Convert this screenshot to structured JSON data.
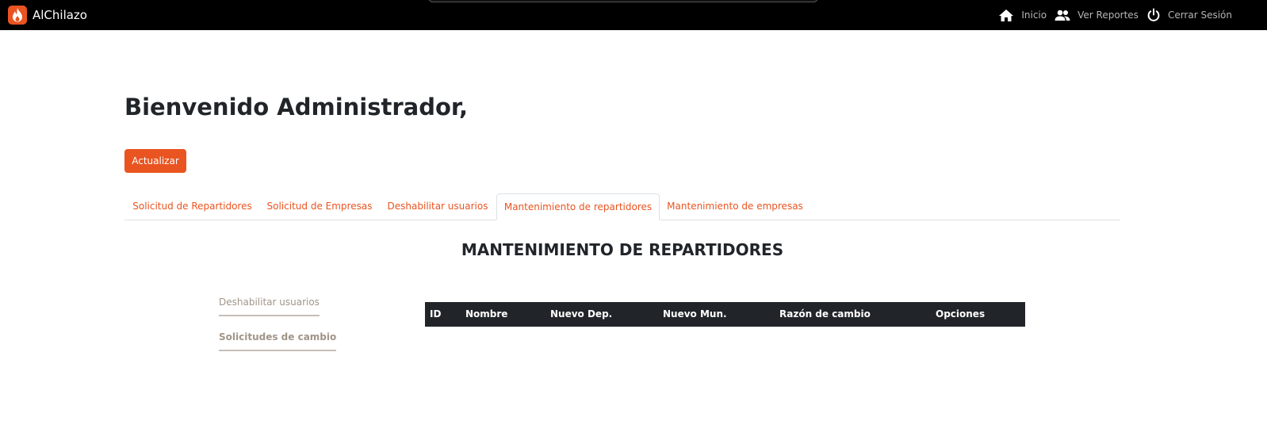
{
  "navbar": {
    "brand": "AlChilazo",
    "links": [
      {
        "label": "Inicio",
        "icon": "home-icon"
      },
      {
        "label": "Ver Reportes",
        "icon": "people-icon"
      },
      {
        "label": "Cerrar Sesión",
        "icon": "power-icon"
      }
    ]
  },
  "main": {
    "welcome": "Bienvenido Administrador,",
    "refresh_label": "Actualizar",
    "tabs": [
      {
        "label": "Solicitud de Repartidores"
      },
      {
        "label": "Solicitud de Empresas"
      },
      {
        "label": "Deshabilitar usuarios"
      },
      {
        "label": "Mantenimiento de repartidores",
        "active": true
      },
      {
        "label": "Mantenimiento de empresas"
      }
    ],
    "section_title": "MANTENIMIENTO DE REPARTIDORES",
    "side_nav": [
      {
        "label": "Deshabilitar usuarios"
      },
      {
        "label": "Solicitudes de cambio",
        "active": true
      }
    ],
    "table": {
      "columns": [
        "ID",
        "Nombre",
        "Nuevo Dep.",
        "Nuevo Mun.",
        "Razón de cambio",
        "Opciones"
      ],
      "rows": []
    }
  },
  "colors": {
    "accent": "#e95420",
    "navbar_bg": "#000000",
    "table_header_bg": "#212529"
  }
}
